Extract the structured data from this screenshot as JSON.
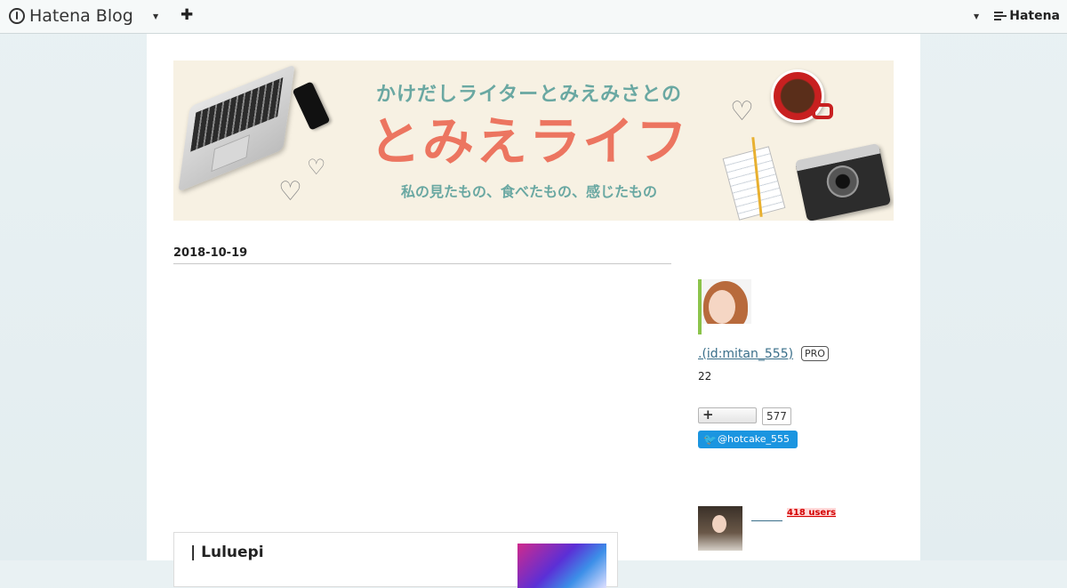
{
  "topbar": {
    "logo_text": "Hatena Blog",
    "right_brand": "Hatena"
  },
  "banner": {
    "line1": "かけだしライターとみえみさとの",
    "title": "とみえライフ",
    "line3": "私の見たもの、食べたもの、感じたもの"
  },
  "article": {
    "date": "2018-10-19",
    "card_title": "| Luluepi"
  },
  "sidebar": {
    "author_link": ".(id:mitan_555)",
    "pro_badge": "PRO",
    "count": "22",
    "reader_count": "577",
    "twitter_handle": "@hotcake_555",
    "users_badge": "418 users"
  },
  "colors": {
    "banner_title": "#ec7560",
    "banner_text": "#6aa8a2",
    "twitter_blue": "#1b95e0",
    "link": "#3a6f8a"
  }
}
